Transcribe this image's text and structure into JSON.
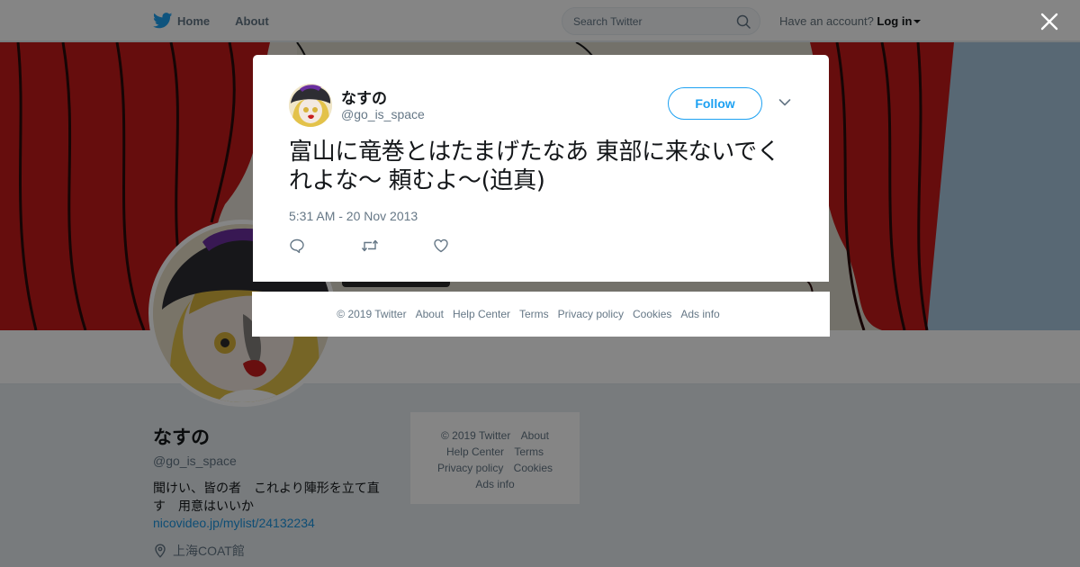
{
  "nav": {
    "home_label": "Home",
    "about_label": "About",
    "search_placeholder": "Search Twitter",
    "account_prompt": "Have an account?",
    "login_label": "Log in"
  },
  "colors": {
    "brand_blue": "#1da1f2",
    "link_blue": "#1b95e0",
    "secondary_text": "#657786",
    "primary_text": "#14171a"
  },
  "icons": [
    "twitter-bird-icon",
    "search-icon",
    "close-icon",
    "chevron-down-icon",
    "reply-icon",
    "retweet-icon",
    "like-icon",
    "location-pin-icon"
  ],
  "profile": {
    "name": "なすの",
    "handle": "@go_is_space",
    "bio": "聞けい、皆の者　これより陣形を立て直す　用意はいいか",
    "link": "nicovideo.jp/mylist/24132234",
    "location": "上海COAT館"
  },
  "side_footer": {
    "copyright": "© 2019 Twitter",
    "about": "About",
    "help_center": "Help Center",
    "terms": "Terms",
    "privacy": "Privacy policy",
    "cookies": "Cookies",
    "ads_info": "Ads info"
  },
  "tweet": {
    "author_name": "なすの",
    "author_handle": "@go_is_space",
    "follow_label": "Follow",
    "text": "富山に竜巻とはたまげたなあ 東部に来ないでくれよな～ 頼むよ～(迫真)",
    "timestamp": "5:31 AM - 20 Nov 2013"
  },
  "modal_footer": {
    "copyright": "© 2019 Twitter",
    "about": "About",
    "help_center": "Help Center",
    "terms": "Terms",
    "privacy": "Privacy policy",
    "cookies": "Cookies",
    "ads_info": "Ads info"
  }
}
